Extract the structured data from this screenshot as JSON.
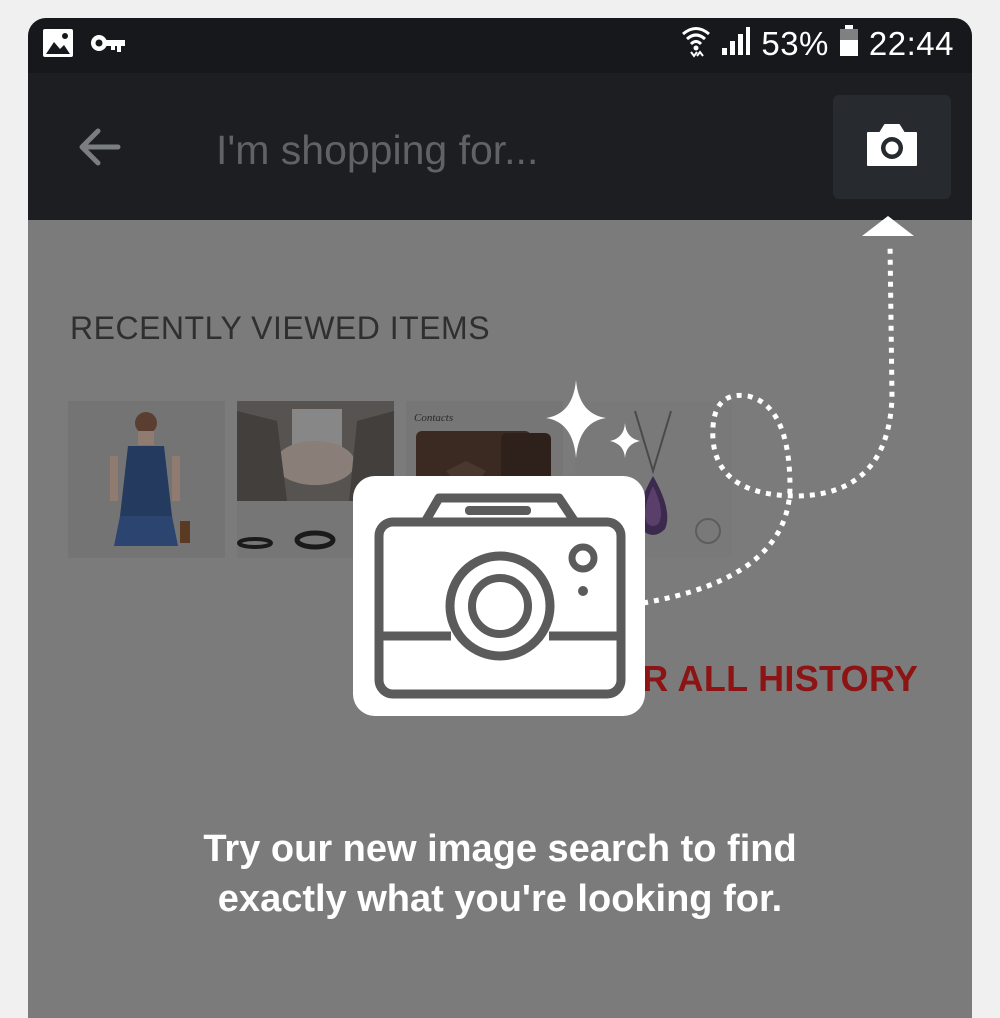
{
  "status_bar": {
    "battery": "53%",
    "time": "22:44"
  },
  "search": {
    "placeholder": "I'm shopping for..."
  },
  "recent": {
    "title": "RECENTLY VIEWED ITEMS",
    "items": [
      {
        "name": "denim-romper"
      },
      {
        "name": "black-rings"
      },
      {
        "name": "brown-wallet"
      },
      {
        "name": "mystic-pendant"
      }
    ]
  },
  "clear_history": "AR ALL HISTORY",
  "promo": {
    "line1": "Try our new image search to find",
    "line2": "exactly what you're looking for."
  },
  "colors": {
    "status_bar": "#16181b",
    "app_bar": "#1c1e21",
    "overlay": "#7b7b7b",
    "accent_red": "#8c1414"
  }
}
